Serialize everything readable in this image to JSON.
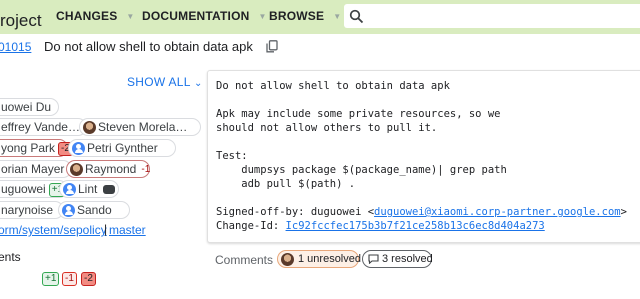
{
  "header": {
    "brand_fragment": "roject",
    "nav": [
      {
        "label": "CHANGES"
      },
      {
        "label": "DOCUMENTATION"
      },
      {
        "label": "BROWSE"
      }
    ],
    "search": {
      "placeholder": "",
      "value": ""
    },
    "colors": {
      "bar": "#d9ecbf"
    }
  },
  "change": {
    "number_fragment": "01015",
    "subject": "Do not allow shell to obtain data apk"
  },
  "sidebar": {
    "show_all": "SHOW ALL",
    "owner": "uowei Du",
    "reviewers_row2": {
      "left": "effrey Vande…",
      "right": "Steven Morela…"
    },
    "row3": {
      "left": "yong Park",
      "left_vote": "-2",
      "right": "Petri Gynther"
    },
    "row4": {
      "left": "orian Mayer",
      "right": "Raymond",
      "right_vote": "-1"
    },
    "row5": {
      "left": "uguowei",
      "left_vote": "+1",
      "right": "Lint"
    },
    "row6": {
      "left": "narynoise",
      "right": "Sando"
    },
    "repo_link": "orm/system/sepolicy",
    "separator": "|",
    "branch_link": "master",
    "section_label": "ents",
    "votes_summary": [
      "+1",
      "-1",
      "-2"
    ]
  },
  "commit_message": {
    "lines": [
      "Do not allow shell to obtain data apk",
      "",
      "Apk may include some private resources, so we",
      "should not allow others to pull it.",
      "",
      "Test:",
      "    dumpsys package $(package_name)| grep path",
      "    adb pull $(path) .",
      ""
    ],
    "signed_off_prefix": "Signed-off-by: duguowei <",
    "signed_off_email": "duguowei@xiaomi.corp-partner.google.com",
    "signed_off_suffix": ">",
    "change_id_prefix": "Change-Id: ",
    "change_id": "Ic92fccfec175b3b7f21ce258b13c6ec8d404a273"
  },
  "comments": {
    "label": "Comments",
    "unresolved": "1 unresolved",
    "resolved": "3 resolved"
  }
}
